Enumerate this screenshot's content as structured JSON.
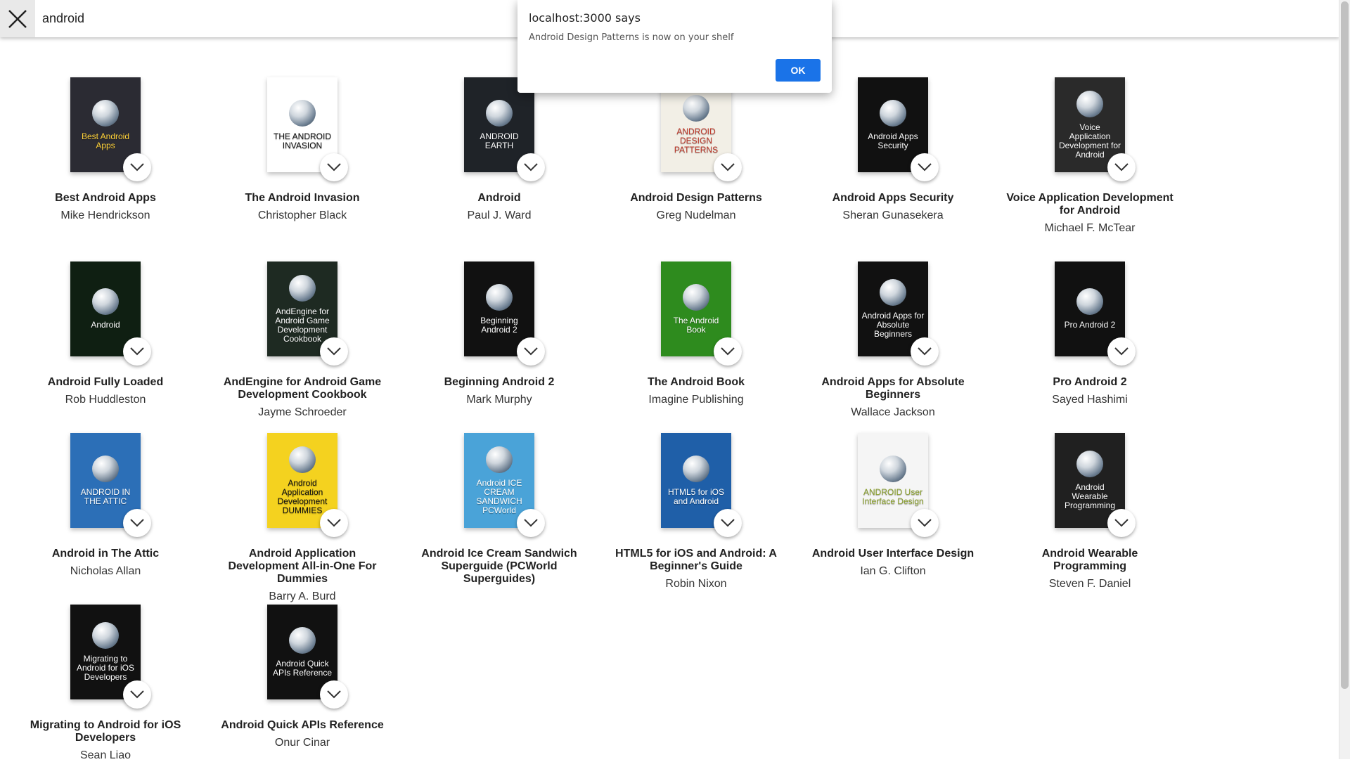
{
  "search": {
    "value": "android",
    "close_icon": "close-icon"
  },
  "dialog": {
    "title": "localhost:3000 says",
    "message": "Android Design Patterns is now on your shelf",
    "ok_label": "OK",
    "ok_color": "#1a73e8"
  },
  "books": [
    {
      "title": "Best Android Apps",
      "author": "Mike Hendrickson",
      "cover_bg": "#2b2b33",
      "cover_fg": "#ffd23a",
      "cover_text": "Best Android Apps"
    },
    {
      "title": "The Android Invasion",
      "author": "Christopher Black",
      "cover_bg": "#ffffff",
      "cover_fg": "#111111",
      "cover_text": "THE ANDROID INVASION"
    },
    {
      "title": "Android",
      "author": "Paul J. Ward",
      "cover_bg": "#1f2328",
      "cover_fg": "#ffffff",
      "cover_text": "ANDROID EARTH"
    },
    {
      "title": "Android Design Patterns",
      "author": "Greg Nudelman",
      "cover_bg": "#f2efe6",
      "cover_fg": "#c0392b",
      "cover_text": "ANDROID DESIGN PATTERNS"
    },
    {
      "title": "Android Apps Security",
      "author": "Sheran Gunasekera",
      "cover_bg": "#111111",
      "cover_fg": "#ffffff",
      "cover_text": "Android Apps Security"
    },
    {
      "title": "Voice Application Development for Android",
      "author": "Michael F. McTear",
      "cover_bg": "#2a2a2a",
      "cover_fg": "#ffffff",
      "cover_text": "Voice Application Development for Android"
    },
    {
      "title": "Android Fully Loaded",
      "author": "Rob Huddleston",
      "cover_bg": "#0f1f12",
      "cover_fg": "#ffffff",
      "cover_text": "Android"
    },
    {
      "title": "AndEngine for Android Game Development Cookbook",
      "author": "Jayme Schroeder",
      "cover_bg": "#1e2a22",
      "cover_fg": "#ffffff",
      "cover_text": "AndEngine for Android Game Development Cookbook"
    },
    {
      "title": "Beginning Android 2",
      "author": "Mark Murphy",
      "cover_bg": "#111111",
      "cover_fg": "#ffffff",
      "cover_text": "Beginning Android 2"
    },
    {
      "title": "The Android Book",
      "author": "Imagine Publishing",
      "cover_bg": "#2e8b1e",
      "cover_fg": "#ffffff",
      "cover_text": "The Android Book"
    },
    {
      "title": "Android Apps for Absolute Beginners",
      "author": "Wallace Jackson",
      "cover_bg": "#111111",
      "cover_fg": "#ffffff",
      "cover_text": "Android Apps for Absolute Beginners"
    },
    {
      "title": "Pro Android 2",
      "author": "Sayed Hashimi",
      "cover_bg": "#111111",
      "cover_fg": "#ffffff",
      "cover_text": "Pro Android 2"
    },
    {
      "title": "Android in The Attic",
      "author": "Nicholas Allan",
      "cover_bg": "#2c6fb7",
      "cover_fg": "#ffffff",
      "cover_text": "ANDROID IN THE ATTIC"
    },
    {
      "title": "Android Application Development All-in-One For Dummies",
      "author": "Barry A. Burd",
      "cover_bg": "#f4d21f",
      "cover_fg": "#111111",
      "cover_text": "Android Application Development DUMMIES"
    },
    {
      "title": "Android Ice Cream Sandwich Superguide (PCWorld Superguides)",
      "author": "",
      "cover_bg": "#4aa3d8",
      "cover_fg": "#ffffff",
      "cover_text": "Android ICE CREAM SANDWICH PCWorld"
    },
    {
      "title": "HTML5 for iOS and Android: A Beginner's Guide",
      "author": "Robin Nixon",
      "cover_bg": "#1f5fa8",
      "cover_fg": "#ffffff",
      "cover_text": "HTML5 for iOS and Android"
    },
    {
      "title": "Android User Interface Design",
      "author": "Ian G. Clifton",
      "cover_bg": "#f5f5f5",
      "cover_fg": "#8aa02c",
      "cover_text": "ANDROID User Interface Design"
    },
    {
      "title": "Android Wearable Programming",
      "author": "Steven F. Daniel",
      "cover_bg": "#202020",
      "cover_fg": "#ffffff",
      "cover_text": "Android Wearable Programming"
    },
    {
      "title": "Migrating to Android for iOS Developers",
      "author": "Sean Liao",
      "cover_bg": "#111111",
      "cover_fg": "#ffffff",
      "cover_text": "Migrating to Android for iOS Developers"
    },
    {
      "title": "Android Quick APIs Reference",
      "author": "Onur Cinar",
      "cover_bg": "#111111",
      "cover_fg": "#ffffff",
      "cover_text": "Android Quick APIs Reference"
    }
  ]
}
